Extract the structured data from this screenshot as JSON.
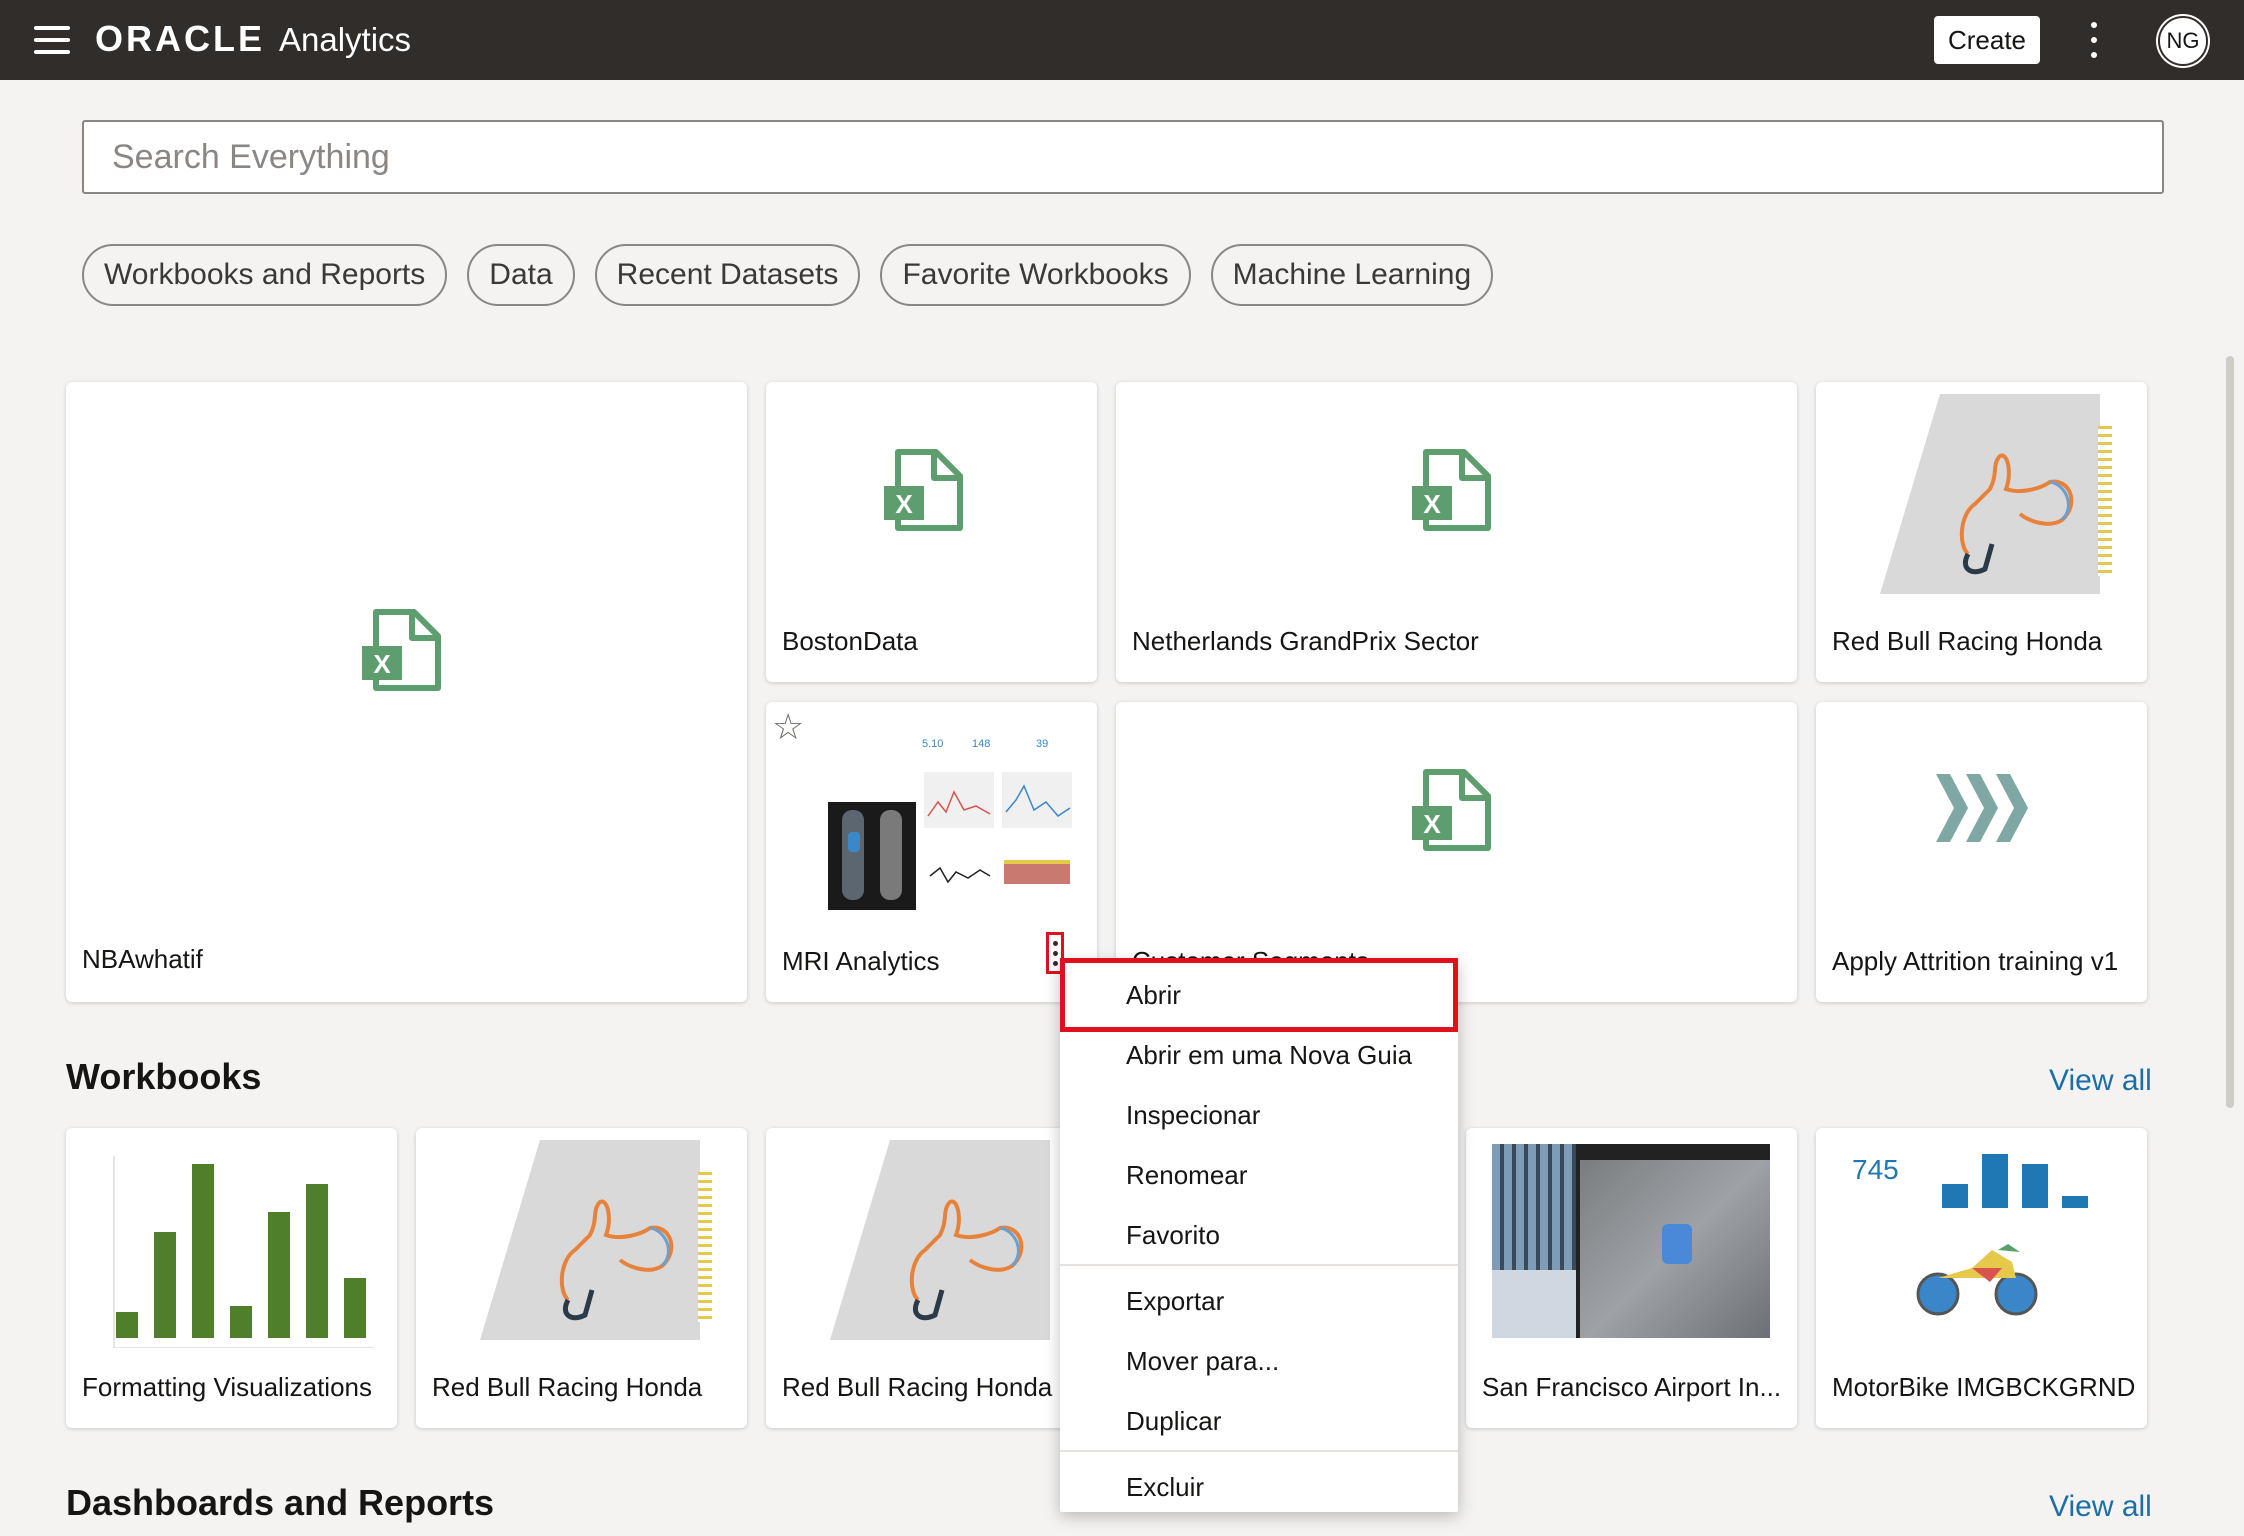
{
  "header": {
    "logo": "ORACLE",
    "product": "Analytics",
    "create_label": "Create",
    "user_initials": "NG"
  },
  "search": {
    "placeholder": "Search Everything",
    "value": ""
  },
  "chips": [
    "Workbooks and Reports",
    "Data",
    "Recent Datasets",
    "Favorite Workbooks",
    "Machine Learning"
  ],
  "recent": {
    "nbawhatif": "NBAwhatif",
    "bostondata": "BostonData",
    "netherlands": "Netherlands GrandPrix Sector",
    "redbull": "Red Bull Racing Honda",
    "mri": "MRI Analytics",
    "obscured": "Customer Segments",
    "attrition": "Apply Attrition training v1",
    "mri_kpis": [
      "5.10",
      "148",
      "39"
    ]
  },
  "workbooks": {
    "title": "Workbooks",
    "view_all": "View all",
    "items": [
      "Formatting Visualizations",
      "Red Bull Racing Honda",
      "Red Bull Racing Honda",
      "San Francisco Airport In...",
      "MotorBike IMGBCKGRND"
    ],
    "motorbike_kpi": "745"
  },
  "dashboards": {
    "title": "Dashboards and Reports",
    "view_all": "View all"
  },
  "context_menu": {
    "items": [
      "Abrir",
      "Abrir em uma Nova Guia",
      "Inspecionar",
      "Renomear",
      "Favorito",
      "Exportar",
      "Mover para...",
      "Duplicar",
      "Excluir"
    ],
    "highlighted": "Abrir"
  },
  "colors": {
    "header_bg": "#312d2a",
    "excel_green": "#5e9e6e",
    "link_blue": "#1a6fa8",
    "highlight_red": "#e0101e",
    "bar_green": "#4f7f2a",
    "bar_blue": "#1f78b4"
  },
  "icons": {
    "excel": "excel-file-icon",
    "attrition": "chevrons-right-icon",
    "favorite": "star-icon"
  }
}
